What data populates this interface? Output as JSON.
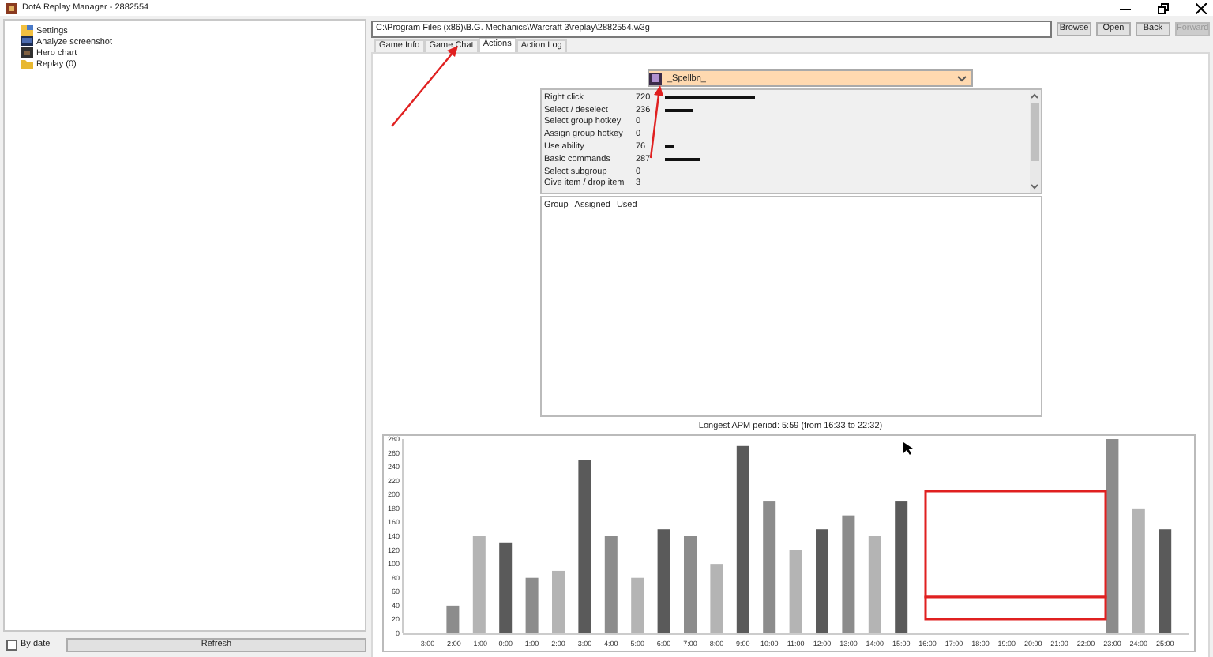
{
  "window": {
    "title": "DotA Replay Manager - 2882554"
  },
  "sidebar": {
    "items": [
      {
        "label": "Settings",
        "kind": "settings"
      },
      {
        "label": "Analyze screenshot",
        "kind": "screen"
      },
      {
        "label": "Hero chart",
        "kind": "chart"
      },
      {
        "label": "Replay (0)",
        "kind": "folder"
      }
    ],
    "by_date": {
      "label": "By date",
      "checked": false
    },
    "refresh": "Refresh"
  },
  "path": {
    "value": "C:\\Program Files (x86)\\B.G. Mechanics\\Warcraft 3\\replay\\2882554.w3g"
  },
  "buttons": [
    {
      "label": "Browse",
      "disabled": false
    },
    {
      "label": "Open",
      "disabled": false
    },
    {
      "label": "Back",
      "disabled": false
    },
    {
      "label": "Forward",
      "disabled": true
    }
  ],
  "tabs": [
    {
      "label": "Game Info",
      "selected": false
    },
    {
      "label": "Game Chat",
      "selected": false
    },
    {
      "label": "Actions",
      "selected": true
    },
    {
      "label": "Action Log",
      "selected": false
    }
  ],
  "player": {
    "name": "_Spellbn_"
  },
  "actions": [
    {
      "name": "Right click",
      "count": "720"
    },
    {
      "name": "Select / deselect",
      "count": "236"
    },
    {
      "name": "Select group hotkey",
      "count": "0"
    },
    {
      "name": "Assign group hotkey",
      "count": "0"
    },
    {
      "name": "Use ability",
      "count": "76"
    },
    {
      "name": "Basic commands",
      "count": "287"
    },
    {
      "name": "Select subgroup",
      "count": "0"
    },
    {
      "name": "Give item / drop item",
      "count": "3"
    }
  ],
  "groups": {
    "columns": [
      "Group",
      "Assigned",
      "Used"
    ]
  },
  "apm_summary": "Longest APM period: 5:59 (from 16:33 to 22:32)",
  "chart_data": {
    "type": "bar",
    "categories": [
      "-3:00",
      "-2:00",
      "-1:00",
      "0:00",
      "1:00",
      "2:00",
      "3:00",
      "4:00",
      "5:00",
      "6:00",
      "7:00",
      "8:00",
      "9:00",
      "10:00",
      "11:00",
      "12:00",
      "13:00",
      "14:00",
      "15:00",
      "16:00",
      "17:00",
      "18:00",
      "19:00",
      "20:00",
      "21:00",
      "22:00",
      "23:00",
      "24:00",
      "25:00"
    ],
    "values": [
      0,
      40,
      140,
      130,
      80,
      90,
      250,
      140,
      80,
      150,
      140,
      100,
      270,
      190,
      120,
      150,
      170,
      140,
      190,
      null,
      null,
      null,
      null,
      null,
      null,
      null,
      280,
      180,
      150
    ],
    "ylim": [
      0,
      280
    ],
    "yticks": [
      0,
      20,
      40,
      60,
      80,
      100,
      120,
      140,
      160,
      180,
      200,
      220,
      240,
      260,
      280
    ]
  }
}
